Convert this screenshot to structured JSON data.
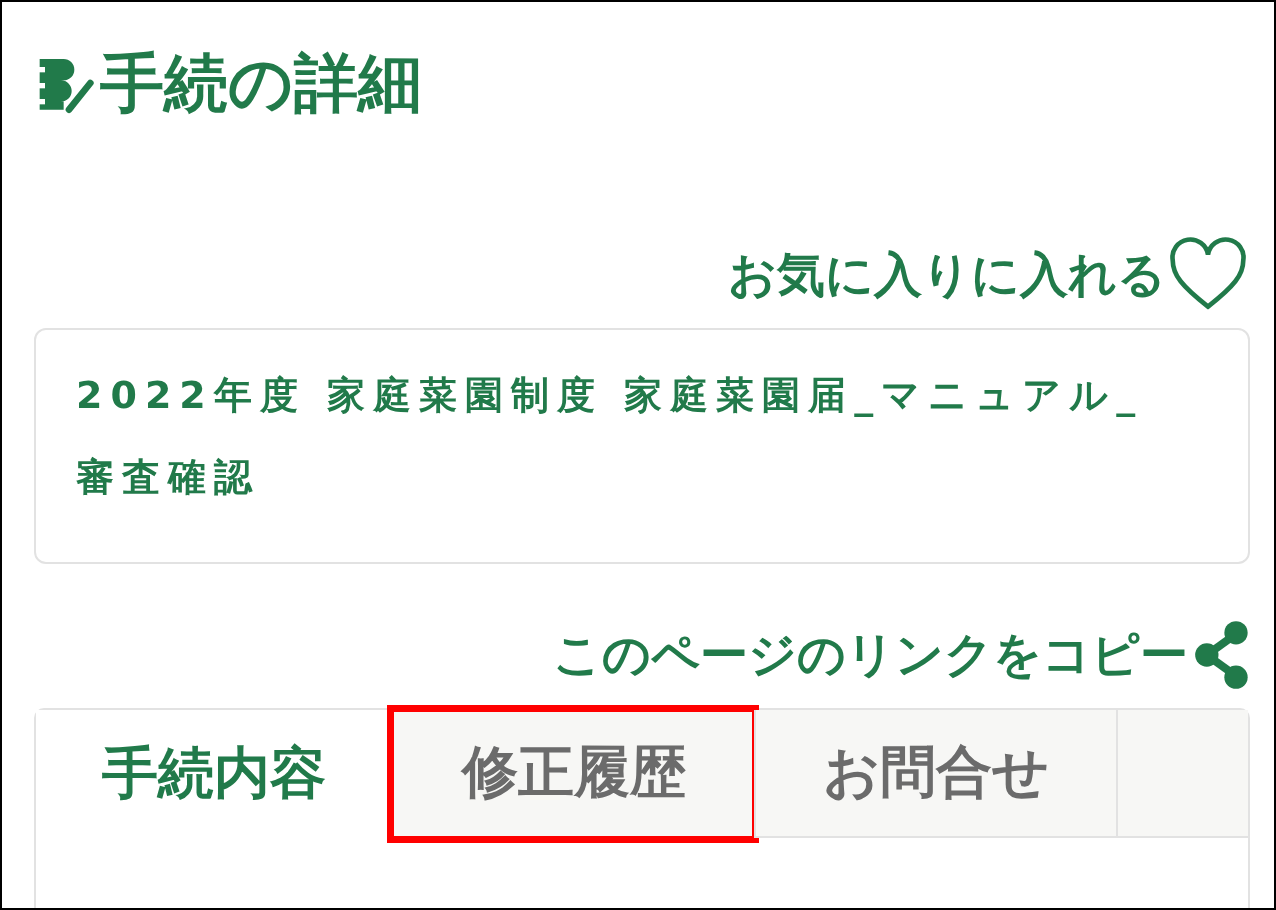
{
  "title": "手続の詳細",
  "favorite": {
    "label": "お気に入りに入れる"
  },
  "procedure_name": "2022年度 家庭菜園制度 家庭菜園届_マニュアル_審査確認",
  "copy_link": {
    "label": "このページのリンクをコピー"
  },
  "tabs": [
    {
      "label": "手続内容",
      "selected": true,
      "highlighted": false
    },
    {
      "label": "修正履歴",
      "selected": false,
      "highlighted": true
    },
    {
      "label": "お問合せ",
      "selected": false,
      "highlighted": false
    }
  ]
}
